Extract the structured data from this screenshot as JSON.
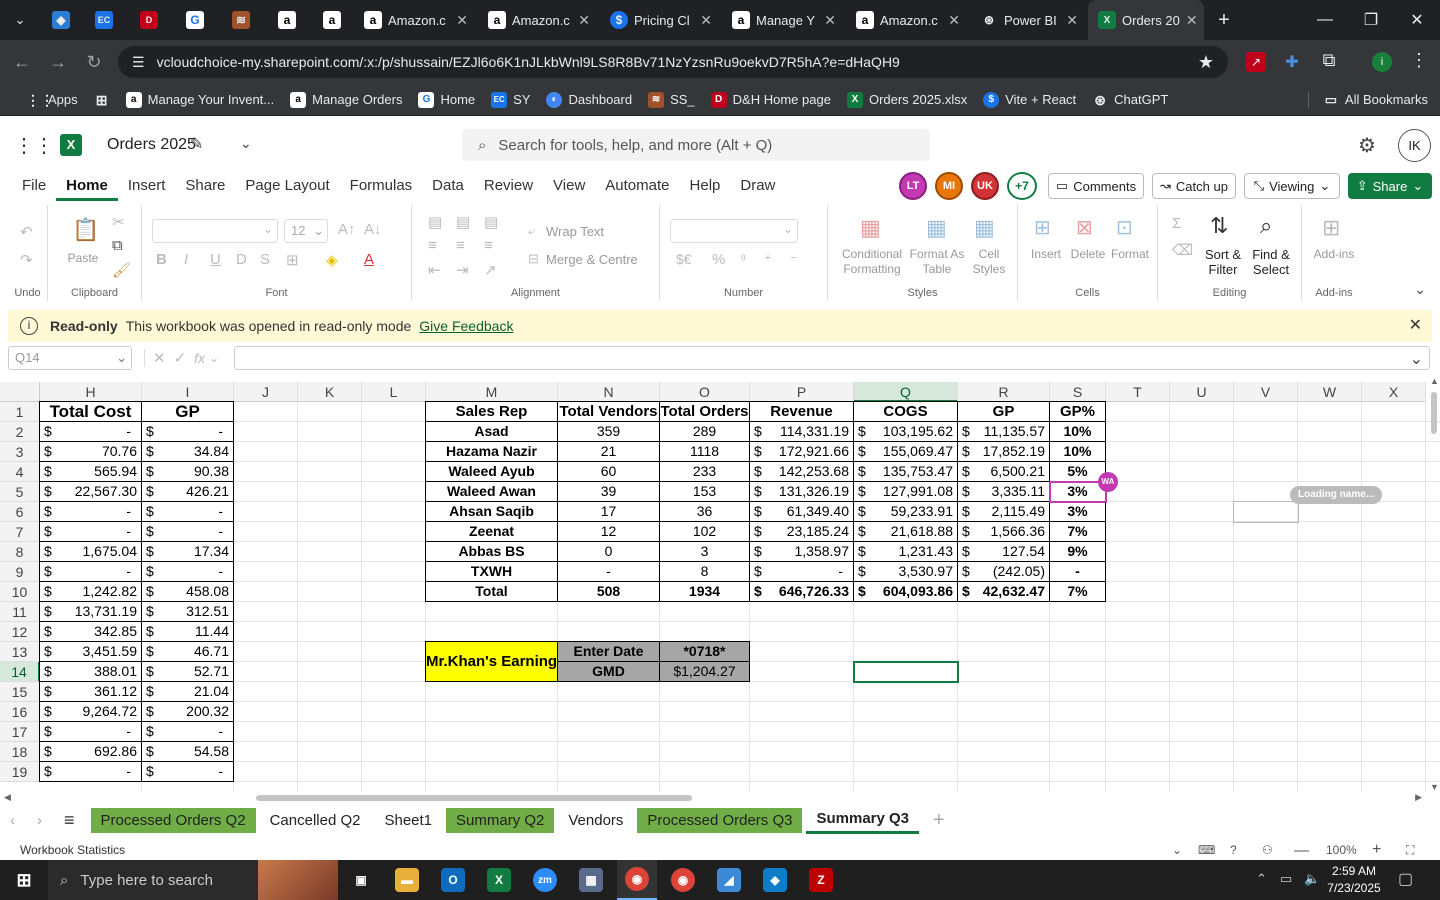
{
  "browser": {
    "tabs": [
      {
        "label": "",
        "icon": "chevron-down"
      },
      {
        "label": "",
        "icon": "vscode"
      },
      {
        "label": "",
        "icon": "ec"
      },
      {
        "label": "",
        "icon": "dh"
      },
      {
        "label": "",
        "icon": "google-classroom"
      },
      {
        "label": "",
        "icon": "ss"
      },
      {
        "label": "",
        "icon": "amazon"
      },
      {
        "label": "",
        "icon": "amazon"
      },
      {
        "label": "Amazon.c",
        "icon": "amazon"
      },
      {
        "label": "Amazon.c",
        "icon": "amazon"
      },
      {
        "label": "Pricing Cl",
        "icon": "dollar"
      },
      {
        "label": "Manage Y",
        "icon": "amazon"
      },
      {
        "label": "Amazon.c",
        "icon": "amazon"
      },
      {
        "label": "Power BI",
        "icon": "powerbi"
      },
      {
        "label": "Orders 20",
        "icon": "excel"
      }
    ],
    "url": "vcloudchoice-my.sharepoint.com/:x:/p/shussain/EZJl6o6K1nJLkbWnl9LS8R8Bv71NzYzsnRu9oekvD7R5hA?e=dHaQH9",
    "bookmarks": [
      {
        "label": "Apps",
        "color": "#4a4a4a"
      },
      {
        "label": "",
        "color": "#4a4a4a"
      },
      {
        "label": "Manage Your Invent...",
        "color": "#000000"
      },
      {
        "label": "Manage Orders",
        "color": "#000000"
      },
      {
        "label": "Home",
        "color": "#1a73e8"
      },
      {
        "label": "SY",
        "color": "#1a73e8"
      },
      {
        "label": "Dashboard",
        "color": "#4285f4"
      },
      {
        "label": "SS_",
        "color": "#c0392b"
      },
      {
        "label": "D&H Home page",
        "color": "#c0001a"
      },
      {
        "label": "Orders 2025.xlsx",
        "color": "#107c41"
      },
      {
        "label": "Vite + React",
        "color": "#1a73e8"
      },
      {
        "label": "ChatGPT",
        "color": "#555555"
      }
    ],
    "all_bookmarks": "All Bookmarks"
  },
  "excel": {
    "title": "Orders 2025",
    "search_placeholder": "Search for tools, help, and more (Alt + Q)",
    "avatar": "IK",
    "menu_tabs": [
      "File",
      "Home",
      "Insert",
      "Share",
      "Page Layout",
      "Formulas",
      "Data",
      "Review",
      "View",
      "Automate",
      "Help",
      "Draw"
    ],
    "active_tab": "Home",
    "presence": [
      "LT",
      "MI",
      "UK",
      "+7"
    ],
    "comments": "Comments",
    "catch_up": "Catch up",
    "viewing": "Viewing",
    "share": "Share",
    "ribbon": {
      "undo": "Undo",
      "clipboard": "Clipboard",
      "paste": "Paste",
      "font": "Font",
      "font_size": "12",
      "alignment": "Alignment",
      "wrap_text": "Wrap Text",
      "merge_centre": "Merge & Centre",
      "number": "Number",
      "styles": "Styles",
      "conditional_formatting": "Conditional Formatting",
      "format_as_table": "Format As Table",
      "cell_styles": "Cell Styles",
      "cells": "Cells",
      "insert": "Insert",
      "delete": "Delete",
      "format": "Format",
      "editing": "Editing",
      "sort_filter": "Sort & Filter",
      "find_select": "Find & Select",
      "addins": "Add-ins",
      "addins_group": "Add-ins"
    },
    "infobar": {
      "title": "Read-only",
      "message": "This workbook was opened in read-only mode",
      "link": "Give Feedback"
    },
    "namebox": "Q14",
    "columns": [
      "H",
      "I",
      "J",
      "K",
      "L",
      "M",
      "N",
      "O",
      "P",
      "Q",
      "R",
      "S",
      "T",
      "U",
      "V",
      "W",
      "X"
    ],
    "rows": [
      "1",
      "2",
      "3",
      "4",
      "5",
      "6",
      "7",
      "8",
      "9",
      "10",
      "11",
      "12",
      "13",
      "14",
      "15",
      "16",
      "17",
      "18",
      "19"
    ],
    "left_table": {
      "headers": [
        "Total Cost",
        "GP"
      ],
      "rows": [
        [
          "-",
          "-"
        ],
        [
          "70.76",
          "34.84"
        ],
        [
          "565.94",
          "90.38"
        ],
        [
          "22,567.30",
          "426.21"
        ],
        [
          "-",
          "-"
        ],
        [
          "-",
          "-"
        ],
        [
          "1,675.04",
          "17.34"
        ],
        [
          "-",
          "-"
        ],
        [
          "1,242.82",
          "458.08"
        ],
        [
          "13,731.19",
          "312.51"
        ],
        [
          "342.85",
          "11.44"
        ],
        [
          "3,451.59",
          "46.71"
        ],
        [
          "388.01",
          "52.71"
        ],
        [
          "361.12",
          "21.04"
        ],
        [
          "9,264.72",
          "200.32"
        ],
        [
          "-",
          "-"
        ],
        [
          "692.86",
          "54.58"
        ],
        [
          "-",
          "-"
        ]
      ]
    },
    "summary_table": {
      "headers": [
        "Sales Rep",
        "Total Vendors",
        "Total Orders",
        "Revenue",
        "COGS",
        "GP",
        "GP%"
      ],
      "rows": [
        [
          "Asad",
          "359",
          "289",
          "114,331.19",
          "103,195.62",
          "11,135.57",
          "10%"
        ],
        [
          "Hazama Nazir",
          "21",
          "1118",
          "172,921.66",
          "155,069.47",
          "17,852.19",
          "10%"
        ],
        [
          "Waleed Ayub",
          "60",
          "233",
          "142,253.68",
          "135,753.47",
          "6,500.21",
          "5%"
        ],
        [
          "Waleed Awan",
          "39",
          "153",
          "131,326.19",
          "127,991.08",
          "3,335.11",
          "3%"
        ],
        [
          "Ahsan Saqib",
          "17",
          "36",
          "61,349.40",
          "59,233.91",
          "2,115.49",
          "3%"
        ],
        [
          "Zeenat",
          "12",
          "102",
          "23,185.24",
          "21,618.88",
          "1,566.36",
          "7%"
        ],
        [
          "Abbas BS",
          "0",
          "3",
          "1,358.97",
          "1,231.43",
          "127.54",
          "9%"
        ],
        [
          "TXWH",
          "-",
          "8",
          "-",
          "3,530.97",
          "(242.05)",
          "-"
        ]
      ],
      "total": [
        "Total",
        "508",
        "1934",
        "646,726.33",
        "604,093.86",
        "42,632.47",
        "7%"
      ]
    },
    "currency": "$",
    "earning": {
      "label": "Mr.Khan's Earning",
      "enter_date": "Enter Date",
      "date_value": "*0718*",
      "gmd": "GMD",
      "gmd_value": "$1,204.27"
    },
    "collab_badge": "WA",
    "loading_name": "Loading name...",
    "sheet_tabs": [
      {
        "label": "Processed Orders Q2",
        "green": true
      },
      {
        "label": "Cancelled Q2",
        "green": false
      },
      {
        "label": "Sheet1",
        "green": false
      },
      {
        "label": "Summary Q2",
        "green": true
      },
      {
        "label": "Vendors",
        "green": false
      },
      {
        "label": "Processed Orders Q3",
        "green": true
      },
      {
        "label": "Summary Q3",
        "green": false
      }
    ],
    "active_sheet": "Summary Q3",
    "status_left": "Workbook Statistics",
    "zoom": "100%"
  },
  "taskbar": {
    "search_placeholder": "Type here to search",
    "time": "2:59 AM",
    "date": "7/23/2025"
  },
  "colors": {
    "excel_green": "#107c41",
    "header_yellow": "#ffff00",
    "earning_grey": "#a6a6a6",
    "tab_green": "#70ad47"
  }
}
